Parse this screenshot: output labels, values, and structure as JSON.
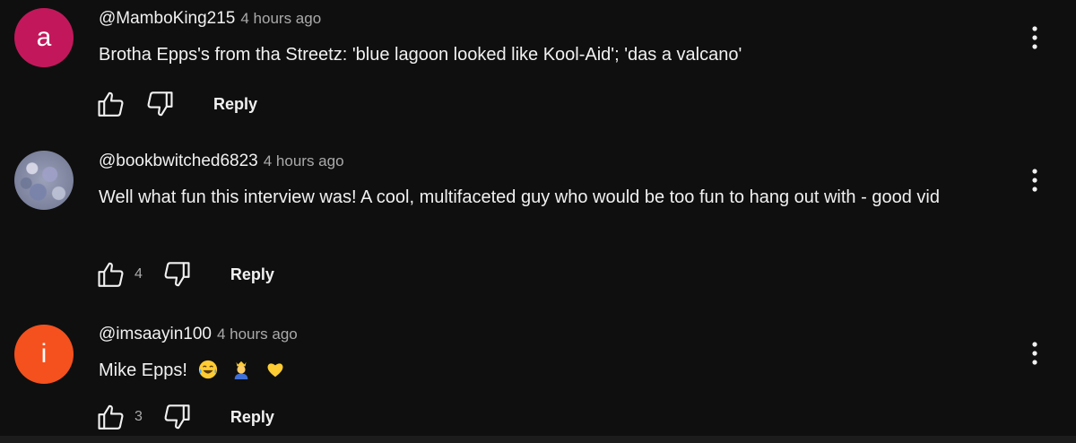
{
  "comments": [
    {
      "avatar_letter": "a",
      "avatar_color": "#c2185b",
      "username": "@MamboKing215",
      "timestamp": "4 hours ago",
      "text": "Brotha Epps's from tha Streetz:  'blue lagoon looked like Kool-Aid'; 'das a valcano'",
      "likes": "",
      "reply_label": "Reply"
    },
    {
      "avatar_letter": "",
      "avatar_color": "#7a7f98",
      "username": "@bookbwitched6823",
      "timestamp": "4 hours ago",
      "text": "Well what fun this interview was! A cool, multifaceted guy who would be too fun to hang out with - good vid",
      "likes": "4",
      "reply_label": "Reply"
    },
    {
      "avatar_letter": "i",
      "avatar_color": "#f4511e",
      "username": "@imsaayin100",
      "timestamp": "4 hours ago",
      "text": "Mike Epps!",
      "emojis": [
        "tears-of-joy-emoji",
        "person-with-crown-emoji",
        "yellow-heart-emoji"
      ],
      "likes": "3",
      "reply_label": "Reply"
    }
  ],
  "icons": {
    "like": "thumbs-up-icon",
    "dislike": "thumbs-down-icon",
    "menu": "more-vertical-icon"
  },
  "colors": {
    "background": "#0f0f0f",
    "text": "#f1f1f1",
    "secondary_text": "#aaaaaa"
  }
}
